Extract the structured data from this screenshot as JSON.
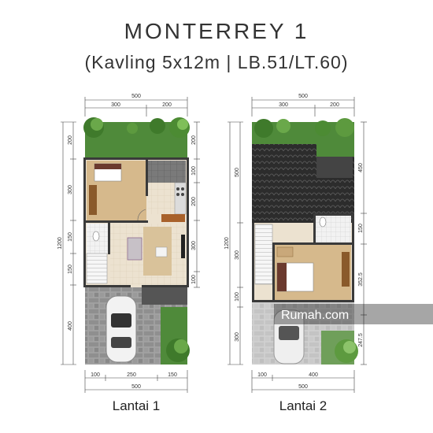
{
  "title": "MONTERREY 1",
  "subtitle": "(Kavling 5x12m | LB.51/LT.60)",
  "watermark": "Rumah.com",
  "floor1": {
    "caption": "Lantai 1",
    "top_dims": [
      "500",
      "300",
      "200"
    ],
    "bottom_dims": [
      "100",
      "250",
      "150",
      "500"
    ],
    "left_dims": [
      "1200",
      "200",
      "300",
      "150",
      "150",
      "400"
    ],
    "right_dims": [
      "200",
      "100",
      "200",
      "300",
      "100"
    ]
  },
  "floor2": {
    "caption": "Lantai 2",
    "top_dims": [
      "500",
      "300",
      "200"
    ],
    "bottom_dims": [
      "100",
      "400",
      "500"
    ],
    "left_dims": [
      "1200",
      "500",
      "300",
      "100",
      "300"
    ],
    "right_dims": [
      "450",
      "150",
      "352.5",
      "247.5"
    ]
  },
  "colors": {
    "grass": "#4f8a3a",
    "roof": "#2c2c2c",
    "paving": "#9a9a9a",
    "wall": "#3a3a3a",
    "floor_tile": "#e8dcc8",
    "parquet": "#d6b98c"
  }
}
